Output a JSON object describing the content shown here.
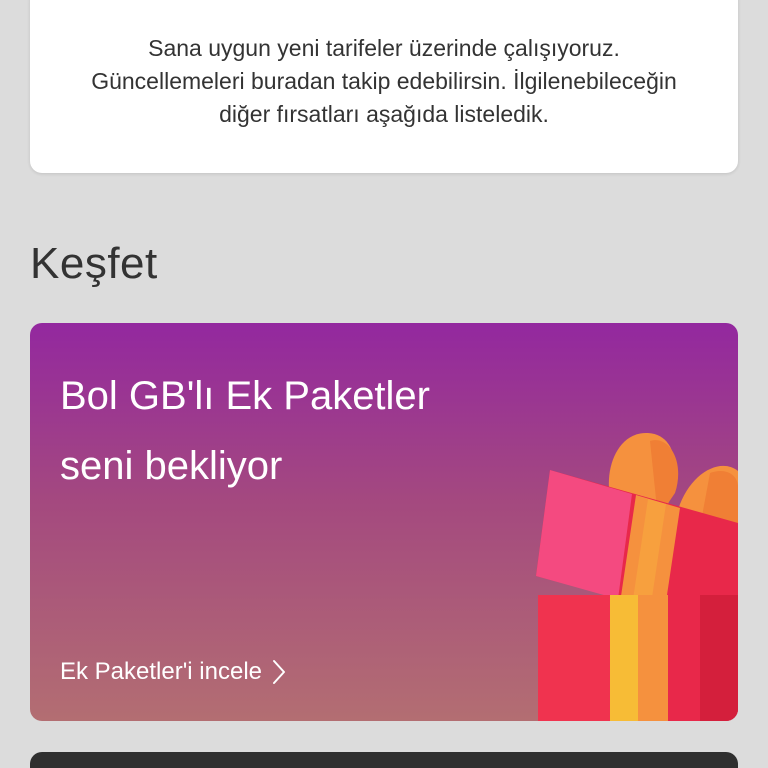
{
  "info": {
    "lines": [
      "Sana uygun yeni tarifeler üzerinde çalışıyoruz.",
      "Güncellemeleri buradan takip edebilirsin. İlgilenebileceğin",
      "diğer fırsatları aşağıda listeledik."
    ]
  },
  "section": {
    "title": "Keşfet"
  },
  "promo": {
    "title_line1": "Bol GB'lı Ek Paketler",
    "title_line2": "seni bekliyor",
    "link_label": "Ek Paketler'i incele",
    "link_icon": "chevron-right-icon",
    "illustration_icon": "gift-box-icon",
    "gradient_top": "#93289f",
    "gradient_bottom": "#b36e72"
  },
  "colors": {
    "background": "#dcdcdc",
    "card": "#ffffff",
    "text": "#333333",
    "gift_red": "#e8284a",
    "gift_orange": "#f5913e",
    "gift_yellow": "#f7bc36",
    "gift_pink": "#f44a80"
  }
}
